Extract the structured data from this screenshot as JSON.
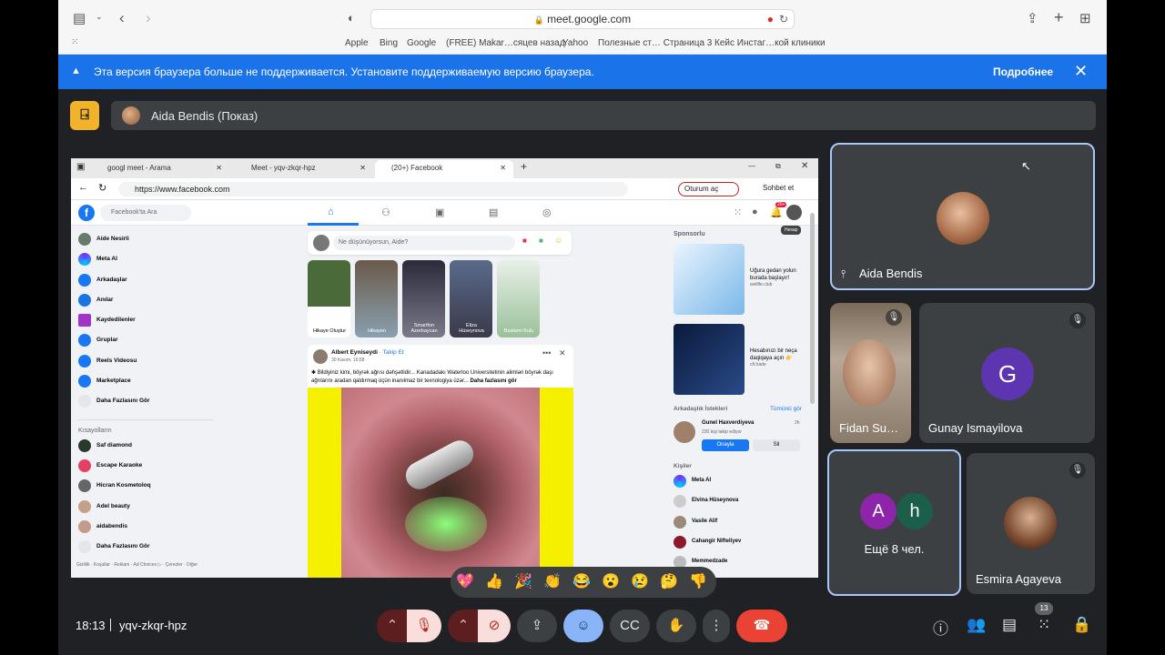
{
  "safari": {
    "url": "meet.google.com",
    "favorites": [
      "Apple",
      "Bing",
      "Google",
      "(FREE) Makar…сяцев назад",
      "Yahoo",
      "Полезные ст… Страница 3",
      "Кейс Инстаг…кой клиники"
    ]
  },
  "banner": {
    "message": "Эта версия браузера больше не поддерживается. Установите поддерживаемую версию браузера.",
    "more": "Подробнее"
  },
  "presenter": {
    "name": "Aida Bendis (Показ)"
  },
  "shared_screen": {
    "tabs": [
      "googl meet - Arama",
      "Meet - yqv-zkqr-hpz",
      "(20+) Facebook"
    ],
    "address": "https://www.facebook.com",
    "login_button": "Oturum aç",
    "chat_button": "Sohbet et",
    "search_placeholder": "Facebook'ta Ara",
    "notification_count": "20+",
    "account_tooltip": "Hesap",
    "left_menu": [
      "Aide Nesirli",
      "Meta AI",
      "Arkadaşlar",
      "Anılar",
      "Kaydedilenler",
      "Gruplar",
      "Reels Videosu",
      "Marketplace",
      "Daha Fazlasını Gör"
    ],
    "shortcuts_head": "Kısayolların",
    "shortcuts": [
      "Saf diamond",
      "Escape Karaoke",
      "Hicran Kosmetoloq",
      "Adel beauty",
      "aidabendis",
      "Daha Fazlasını Gör"
    ],
    "footer": "Gizlilik · Koşullar · Reklam · Ad Choices ▷ · Çerezler · Diğer",
    "composer_placeholder": "Ne düşünüyorsun, Aide?",
    "stories": [
      "Hikaye Oluştur",
      "Hikayen",
      "Smartfon Azerbaycan",
      "Eliza Hüseynova",
      "Bestami Kulu"
    ],
    "post": {
      "author": "Albert Eyniseydi",
      "follow": "· Takip Et",
      "date": "30 Kasım, 16:58 · ",
      "text": "✱ Bildiyiniz kimi, böyrək ağrısı dəhşətlidir... Kanadadakı Waterloo Universitetinin alimləri böyrək daşı ağrılarını aradan qaldırmaq üçün inanılmaz bir texnologiya üzər...",
      "more": "Daha fazlasını gör"
    },
    "sponsored_head": "Sponsorlu",
    "ads": [
      {
        "title": "Uğura gedan yolun burada başlayır!",
        "source": "wellife.club"
      },
      {
        "title": "Hesabınızı bir neça daqiqaya açın 👉",
        "source": "cfi.trade"
      }
    ],
    "friend_requests_head": "Arkadaşlık İstekleri",
    "friend_requests_all": "Tümünü gör",
    "friend_request": {
      "name": "Gunel Haxverdiyeva",
      "mutual": "230 kişi takip ediyor",
      "age": "2h",
      "confirm": "Onayla",
      "delete": "Sil"
    },
    "contacts_head": "Kişiler",
    "contacts": [
      "Meta AI",
      "Elvina Hüseynova",
      "Vasile Alif",
      "Cahangir Nifteliyev",
      "Memmedzade"
    ]
  },
  "reactions": [
    "💖",
    "👍",
    "🎉",
    "👏",
    "😂",
    "😮",
    "😢",
    "🤔",
    "👎"
  ],
  "participants": [
    {
      "name": "Aida Bendis"
    },
    {
      "name": "Fidan Su…"
    },
    {
      "name": "Gunay Ismayilova",
      "initial": "G",
      "color": "#5e35b1"
    },
    {
      "name": "Ещё 8 чел.",
      "initials": [
        "A",
        "h"
      ],
      "colors": [
        "#8e24aa",
        "#1b5e4a"
      ]
    },
    {
      "name": "Esmira Agayeva"
    }
  ],
  "meeting": {
    "time": "18:13",
    "code": "yqv-zkqr-hpz",
    "participant_count": "13"
  }
}
